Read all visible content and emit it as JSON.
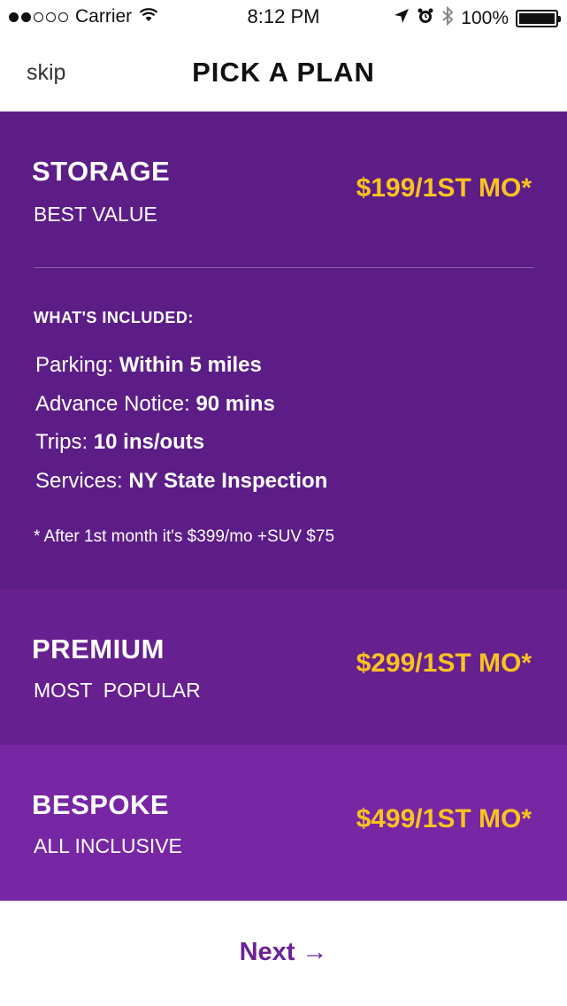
{
  "status_bar": {
    "carrier": "Carrier",
    "time": "8:12 PM",
    "battery": "100%",
    "battery_level": 1.0,
    "signal_bars": 2,
    "icons": [
      "wifi-icon",
      "location-arrow-icon",
      "alarm-icon",
      "bluetooth-icon",
      "battery-icon"
    ]
  },
  "nav": {
    "skip_label": "skip",
    "title": "PICK A PLAN"
  },
  "plans": [
    {
      "name": "STORAGE",
      "subtitle": "BEST VALUE",
      "price": "$199/1ST MO*",
      "included_title": "WHAT'S INCLUDED:",
      "features": [
        {
          "label": "Parking:",
          "value": "Within 5 miles"
        },
        {
          "label": "Advance Notice:",
          "value": "90 mins"
        },
        {
          "label": "Trips:",
          "value": "10 ins/outs"
        },
        {
          "label": "Services:",
          "value": "NY State Inspection"
        }
      ],
      "footnote": "* After 1st month it's $399/mo +SUV $75"
    },
    {
      "name": "PREMIUM",
      "subtitle": "MOST  POPULAR",
      "price": "$299/1ST MO*"
    },
    {
      "name": "BESPOKE",
      "subtitle": "ALL INCLUSIVE",
      "price": "$499/1ST MO*"
    }
  ],
  "next_label": "Next",
  "next_arrow": "→",
  "colors": {
    "storage_bg": "#5c1d87",
    "premium_bg": "#67208f",
    "bespoke_bg": "#7726a4",
    "price_accent": "#f8c321",
    "next_text": "#6a2296"
  }
}
